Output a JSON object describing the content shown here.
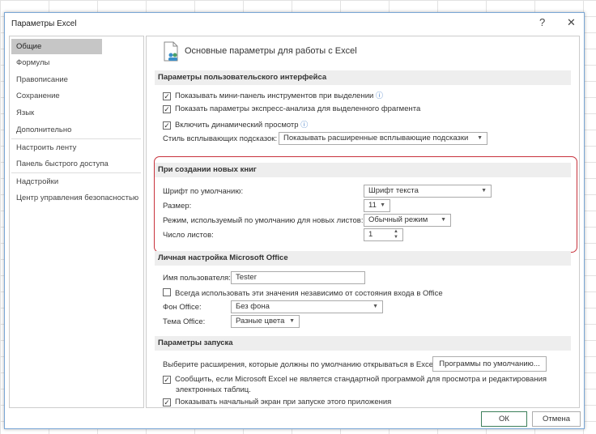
{
  "window": {
    "title": "Параметры Excel",
    "help": "?",
    "close": "✕"
  },
  "nav": [
    "Общие",
    "Формулы",
    "Правописание",
    "Сохранение",
    "Язык",
    "Дополнительно",
    "Настроить ленту",
    "Панель быстрого доступа",
    "Надстройки",
    "Центр управления безопасностью"
  ],
  "main": {
    "heading": "Основные параметры для работы с Excel",
    "ui": {
      "header": "Параметры пользовательского интерфейса",
      "mini_toolbar": "Показывать мини-панель инструментов при выделении",
      "quick_analysis": "Показать параметры экспресс-анализа для выделенного фрагмента",
      "live_preview": "Включить динамический просмотр",
      "tooltip_label": "Стиль всплывающих подсказок:",
      "tooltip_value": "Показывать расширенные всплывающие подсказки"
    },
    "new_books": {
      "header": "При создании новых книг",
      "font_label": "Шрифт по умолчанию:",
      "font_value": "Шрифт текста",
      "size_label": "Размер:",
      "size_value": "11",
      "view_label": "Режим, используемый по умолчанию для новых листов:",
      "view_value": "Обычный режим",
      "sheets_label": "Число листов:",
      "sheets_value": "1"
    },
    "personal": {
      "header": "Личная настройка Microsoft Office",
      "user_label": "Имя пользователя:",
      "user_value": "Tester",
      "always_use": "Всегда использовать эти значения независимо от состояния входа в Office",
      "bg_label": "Фон Office:",
      "bg_value": "Без фона",
      "theme_label": "Тема Office:",
      "theme_value": "Разные цвета"
    },
    "startup": {
      "header": "Параметры запуска",
      "ext_label": "Выберите расширения, которые должны по умолчанию открываться в Excel:",
      "default_programs": "Программы по умолчанию...",
      "notify_line1": "Сообщить, если Microsoft Excel не является стандартной программой для просмотра и редактирования",
      "notify_line2": "электронных таблиц.",
      "start_screen": "Показывать начальный экран при запуске этого приложения"
    }
  },
  "buttons": {
    "ok": "ОК",
    "cancel": "Отмена"
  },
  "checks": {
    "check": "✓",
    "info": "ⓘ"
  }
}
